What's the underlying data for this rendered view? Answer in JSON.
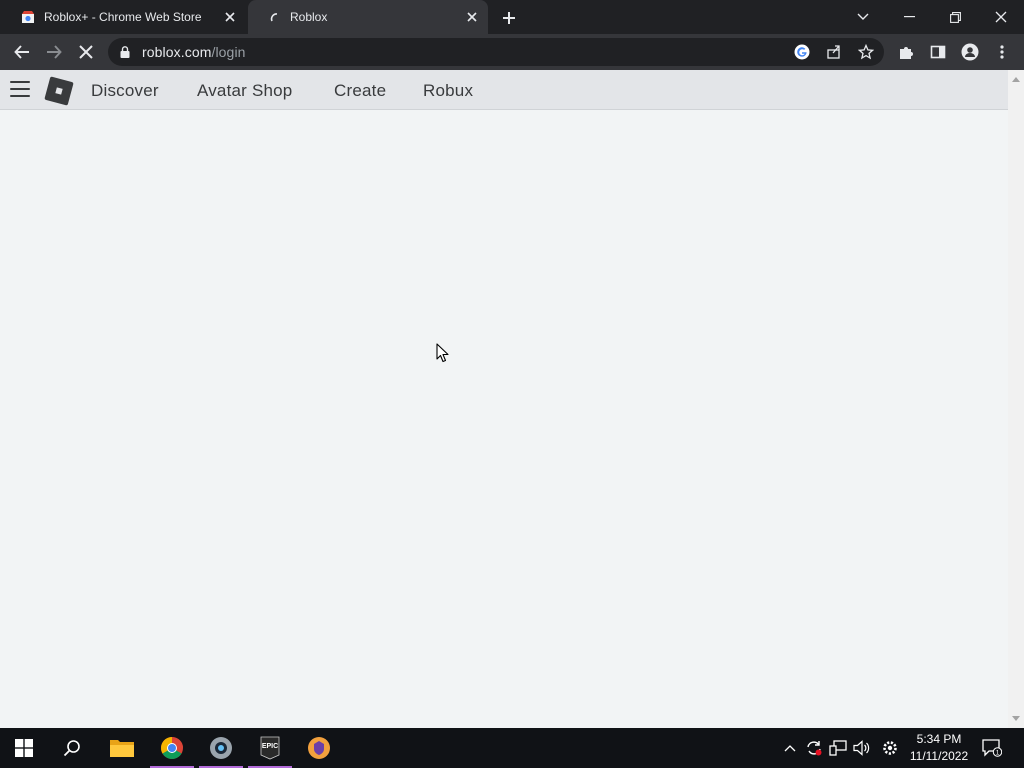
{
  "browser": {
    "tabs": [
      {
        "title": "Roblox+ - Chrome Web Store",
        "favicon": "chrome-web-store-icon",
        "active": false
      },
      {
        "title": "Roblox",
        "favicon": "loading-spinner-icon",
        "active": true
      }
    ],
    "new_tab_icon": "plus-icon",
    "window_controls": [
      "tab-search-icon",
      "minimize-icon",
      "restore-icon",
      "close-icon"
    ],
    "url": {
      "host": "roblox.com",
      "path": "/login"
    },
    "loading": true,
    "omnibox_icons": [
      "google-icon",
      "share-icon",
      "bookmark-star-icon"
    ],
    "toolbar_icons": [
      "extensions-puzzle-icon",
      "side-panel-icon",
      "profile-icon",
      "more-vert-icon"
    ]
  },
  "roblox": {
    "nav": [
      "Discover",
      "Avatar Shop",
      "Create",
      "Robux"
    ]
  },
  "taskbar": {
    "apps": [
      {
        "name": "file-explorer-icon",
        "active": false
      },
      {
        "name": "chrome-icon",
        "active": true
      },
      {
        "name": "steam-icon",
        "active": true
      },
      {
        "name": "epic-games-icon",
        "active": true
      },
      {
        "name": "brave-vpn-icon",
        "active": false
      }
    ],
    "epic_label": "EPIC",
    "clock": {
      "time": "5:34 PM",
      "date": "11/11/2022"
    },
    "notification_count": "1"
  },
  "colors": {
    "tabstrip": "#202124",
    "toolbar": "#35363a",
    "page_bg": "#f2f4f5",
    "header_bg": "#e3e5e8",
    "nav_text": "#393b3d",
    "taskbar": "#101216",
    "task_indicator": "#b36bd9"
  }
}
